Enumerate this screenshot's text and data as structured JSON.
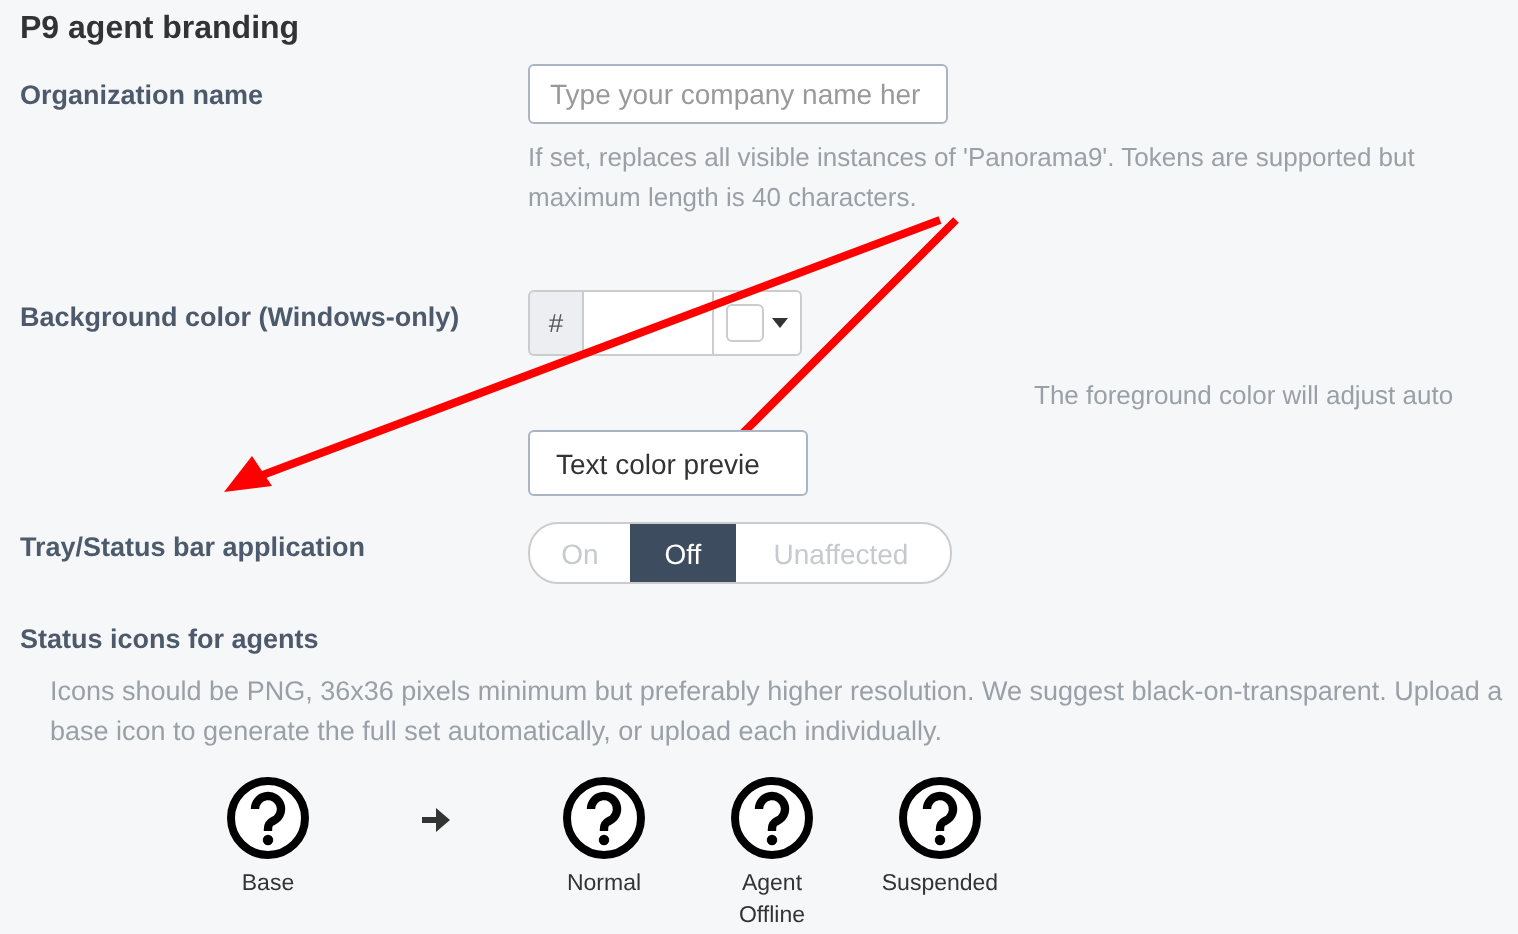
{
  "section_title": "P9 agent branding",
  "organization_name": {
    "label": "Organization name",
    "placeholder": "Type your company name her",
    "hint": "If set, replaces all visible instances of 'Panorama9'. Tokens are supported but maximum length is 40 characters."
  },
  "background_color": {
    "label": "Background color (Windows-only)",
    "prefix": "#",
    "note": "The foreground color will adjust auto",
    "preview_button": "Text color previe"
  },
  "tray_app": {
    "label": "Tray/Status bar application",
    "options": [
      {
        "label": "On",
        "selected": false
      },
      {
        "label": "Off",
        "selected": true
      },
      {
        "label": "Unaffected",
        "selected": false
      }
    ]
  },
  "status_icons": {
    "title": "Status icons for agents",
    "description": "Icons should be PNG, 36x36 pixels minimum but preferably higher resolution. We suggest black-on-transparent. Upload a base icon to generate the full set automatically, or upload each individually.",
    "icons": [
      {
        "kind": "icon",
        "label": "Base"
      },
      {
        "kind": "arrow"
      },
      {
        "kind": "icon",
        "label": "Normal"
      },
      {
        "kind": "icon",
        "label": "Agent Offline"
      },
      {
        "kind": "icon",
        "label": "Suspended"
      }
    ]
  }
}
